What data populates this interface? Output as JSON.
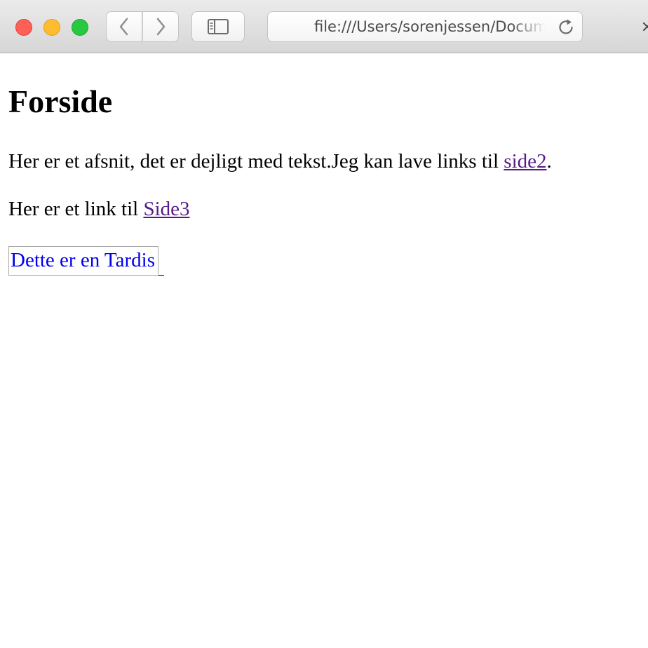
{
  "browser": {
    "address_url": "file:///Users/sorenjessen/Documents/",
    "icons": {
      "back": "chevron-left-icon",
      "forward": "chevron-right-icon",
      "sidebar": "sidebar-icon",
      "reload": "reload-icon",
      "close_tab": "close-icon"
    },
    "traffic_lights": {
      "close": "#fe5f57",
      "minimize": "#febc2e",
      "zoom": "#28c840"
    }
  },
  "page": {
    "heading": "Forside",
    "paragraph1": {
      "text_before": "Her er et afsnit, det er dejligt med tekst.Jeg kan lave links til ",
      "link_text": "side2",
      "text_after": "."
    },
    "paragraph2": {
      "text_before": "Her er et link til ",
      "link_text": "Side3"
    },
    "image_link_alt": "Dette er en Tardis",
    "colors": {
      "visited_link": "#551a8b",
      "link": "#0000ee",
      "text": "#000000"
    }
  }
}
